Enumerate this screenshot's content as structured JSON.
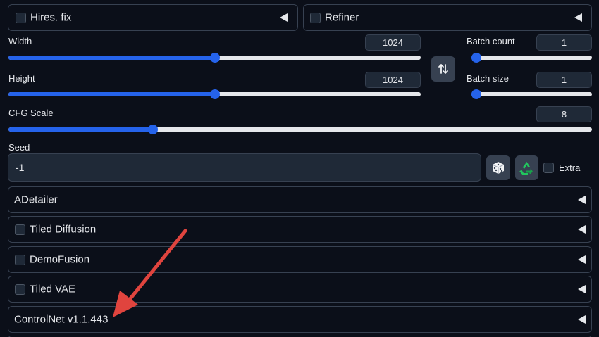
{
  "top_accordions": {
    "hires_fix": {
      "label": "Hires. fix"
    },
    "refiner": {
      "label": "Refiner"
    }
  },
  "width": {
    "label": "Width",
    "value": "1024",
    "fraction": 0.5
  },
  "height": {
    "label": "Height",
    "value": "1024",
    "fraction": 0.5
  },
  "batch_count": {
    "label": "Batch count",
    "value": "1",
    "fraction": 0.0
  },
  "batch_size": {
    "label": "Batch size",
    "value": "1",
    "fraction": 0.0
  },
  "cfg_scale": {
    "label": "CFG Scale",
    "value": "8",
    "fraction": 0.247
  },
  "seed": {
    "label": "Seed",
    "value": "-1",
    "extra_label": "Extra"
  },
  "accordions": [
    {
      "label": "ADetailer",
      "has_checkbox": false
    },
    {
      "label": "Tiled Diffusion",
      "has_checkbox": true
    },
    {
      "label": "DemoFusion",
      "has_checkbox": true
    },
    {
      "label": "Tiled VAE",
      "has_checkbox": true
    },
    {
      "label": "ControlNet v1.1.443",
      "has_checkbox": false
    }
  ],
  "colors": {
    "accent": "#2563eb",
    "annotation_arrow": "#e0443e",
    "recycle_green": "#22c55e"
  },
  "icons": {
    "swap": "swap-dimensions-icon",
    "dice": "dice-icon",
    "recycle": "recycle-icon"
  }
}
